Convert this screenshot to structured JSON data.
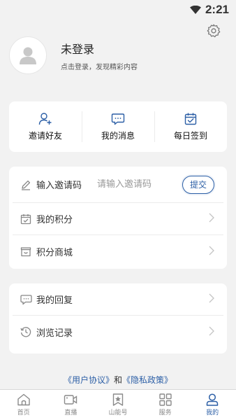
{
  "status_bar": {
    "time": "2:21",
    "icons": [
      "wifi-icon"
    ]
  },
  "header": {
    "settings_icon": "gear-icon"
  },
  "profile": {
    "name": "未登录",
    "subtitle": "点击登录，发现精彩内容",
    "avatar_icon": "person-icon"
  },
  "quick_actions": [
    {
      "label": "邀请好友",
      "icon": "add-user-icon"
    },
    {
      "label": "我的消息",
      "icon": "message-icon"
    },
    {
      "label": "每日签到",
      "icon": "calendar-check-icon"
    }
  ],
  "invite": {
    "label": "输入邀请码",
    "placeholder": "请输入邀请码",
    "value": "",
    "submit_label": "提交",
    "icon": "pencil-icon"
  },
  "menu_group1": [
    {
      "label": "我的积分",
      "icon": "points-calendar-icon"
    },
    {
      "label": "积分商城",
      "icon": "gift-box-icon"
    }
  ],
  "menu_group2": [
    {
      "label": "我的回复",
      "icon": "chat-icon"
    },
    {
      "label": "浏览记录",
      "icon": "history-clock-icon"
    }
  ],
  "agreement": {
    "user_agreement": "《用户协议》",
    "and": "和",
    "privacy_policy": "《隐私政策》"
  },
  "tabs": [
    {
      "label": "首页",
      "icon": "home-icon",
      "active": false
    },
    {
      "label": "直播",
      "icon": "video-icon",
      "active": false
    },
    {
      "label": "山能号",
      "icon": "star-bookmark-icon",
      "active": false
    },
    {
      "label": "服务",
      "icon": "grid-icon",
      "active": false
    },
    {
      "label": "我的",
      "icon": "user-icon",
      "active": true
    }
  ],
  "colors": {
    "accent": "#2c5fa6",
    "background": "#f2f2f2",
    "card": "#ffffff",
    "icon_gray": "#888888"
  }
}
